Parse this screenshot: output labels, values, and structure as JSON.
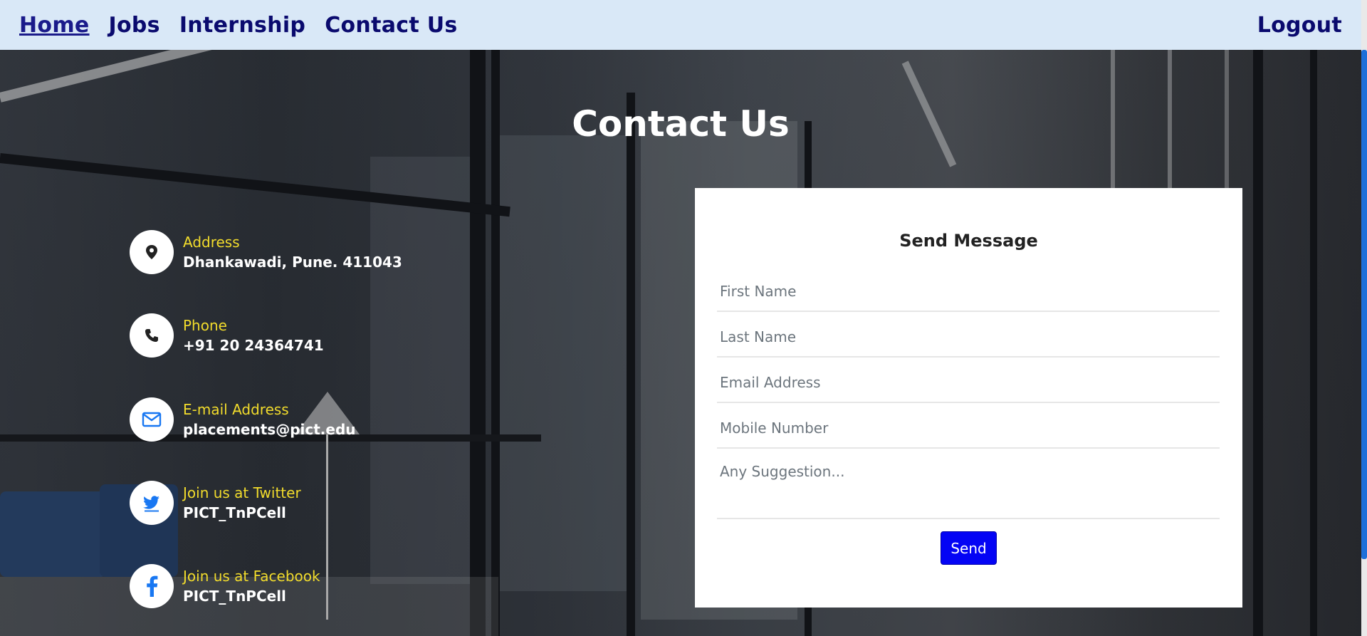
{
  "nav": {
    "links": [
      "Home",
      "Jobs",
      "Internship",
      "Contact Us"
    ],
    "logout": "Logout",
    "active": "Home"
  },
  "page": {
    "title": "Contact Us"
  },
  "contact_info": [
    {
      "label": "Address",
      "value": "Dhankawadi, Pune. 411043",
      "icon": "map-pin-icon"
    },
    {
      "label": "Phone",
      "value": "+91 20 24364741",
      "icon": "phone-icon"
    },
    {
      "label": "E-mail Address",
      "value": "placements@pict.edu",
      "icon": "envelope-icon"
    },
    {
      "label": "Join us at Twitter",
      "value": "PICT_TnPCell",
      "icon": "twitter-icon"
    },
    {
      "label": "Join us at Facebook",
      "value": "PICT_TnPCell",
      "icon": "facebook-icon"
    }
  ],
  "form": {
    "title": "Send Message",
    "first_name_placeholder": "First Name",
    "last_name_placeholder": "Last Name",
    "email_placeholder": "Email Address",
    "mobile_placeholder": "Mobile Number",
    "suggestion_placeholder": "Any Suggestion...",
    "send_label": "Send"
  },
  "colors": {
    "nav_bg": "#d9e8f7",
    "nav_text": "#0a0a6e",
    "label_yellow": "#f2dc2c",
    "send_button": "#0404f5",
    "icon_blue": "#1877f2"
  }
}
